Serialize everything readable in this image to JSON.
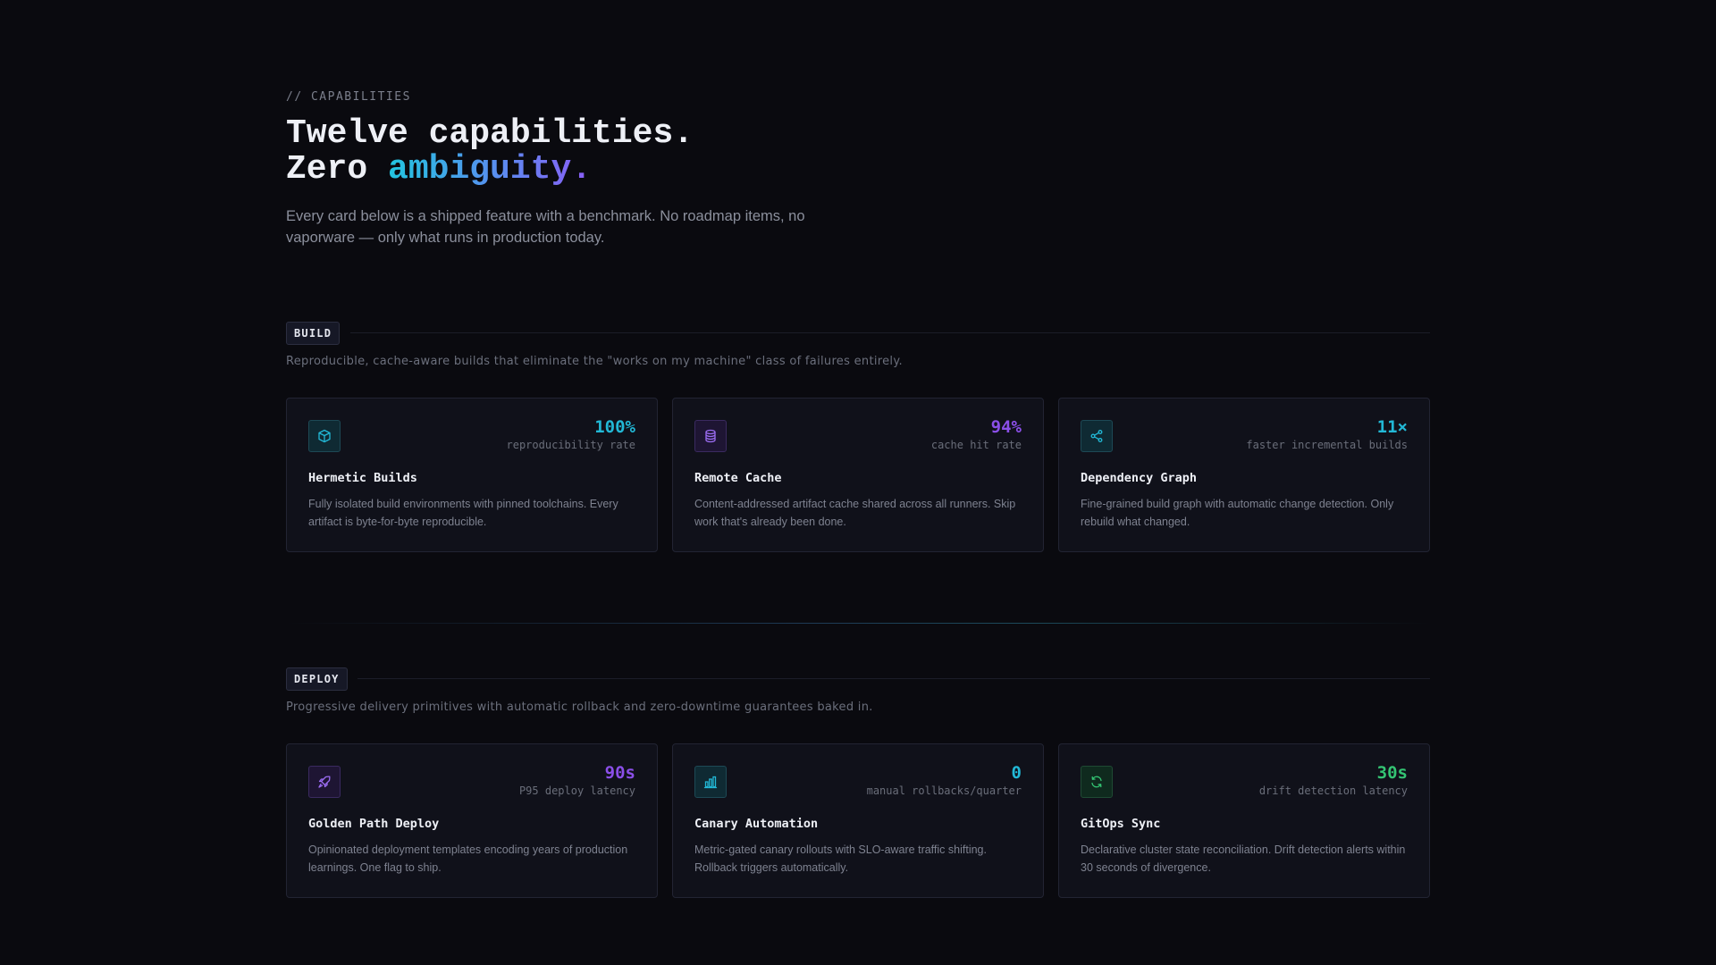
{
  "eyebrow": "// CAPABILITIES",
  "headline": {
    "line1": "Twelve capabilities.",
    "line2_plain": "Zero ",
    "line2_accent": "ambiguity."
  },
  "lead": "Every card below is a shipped feature with a benchmark. No roadmap items, no vaporware — only what runs in production today.",
  "sections": [
    {
      "tag": "BUILD",
      "description": "Reproducible, cache-aware builds that eliminate the \"works on my machine\" class of failures entirely.",
      "cards": [
        {
          "icon": "cube-icon",
          "accent": "#22b8d6",
          "metric": "100%",
          "metric_label": "reproducibility rate",
          "title": "Hermetic Builds",
          "description": "Fully isolated build environments with pinned toolchains. Every artifact is byte-for-byte reproducible."
        },
        {
          "icon": "database-icon",
          "accent": "#8b4fe8",
          "metric": "94%",
          "metric_label": "cache hit rate",
          "title": "Remote Cache",
          "description": "Content-addressed artifact cache shared across all runners. Skip work that's already been done."
        },
        {
          "icon": "share-graph-icon",
          "accent": "#22b8d6",
          "metric": "11×",
          "metric_label": "faster incremental builds",
          "title": "Dependency Graph",
          "description": "Fine-grained build graph with automatic change detection. Only rebuild what changed."
        }
      ]
    },
    {
      "tag": "DEPLOY",
      "description": "Progressive delivery primitives with automatic rollback and zero-downtime guarantees baked in.",
      "cards": [
        {
          "icon": "rocket-icon",
          "accent": "#8b4fe8",
          "metric": "90s",
          "metric_label": "P95 deploy latency",
          "title": "Golden Path Deploy",
          "description": "Opinionated deployment templates encoding years of production learnings. One flag to ship."
        },
        {
          "icon": "bar-chart-icon",
          "accent": "#22b8d6",
          "metric": "0",
          "metric_label": "manual rollbacks/quarter",
          "title": "Canary Automation",
          "description": "Metric-gated canary rollouts with SLO-aware traffic shifting. Rollback triggers automatically."
        },
        {
          "icon": "sync-icon",
          "accent": "#34c473",
          "metric": "30s",
          "metric_label": "drift detection latency",
          "title": "GitOps Sync",
          "description": "Declarative cluster state reconciliation. Drift detection alerts within 30 seconds of divergence."
        }
      ]
    }
  ]
}
